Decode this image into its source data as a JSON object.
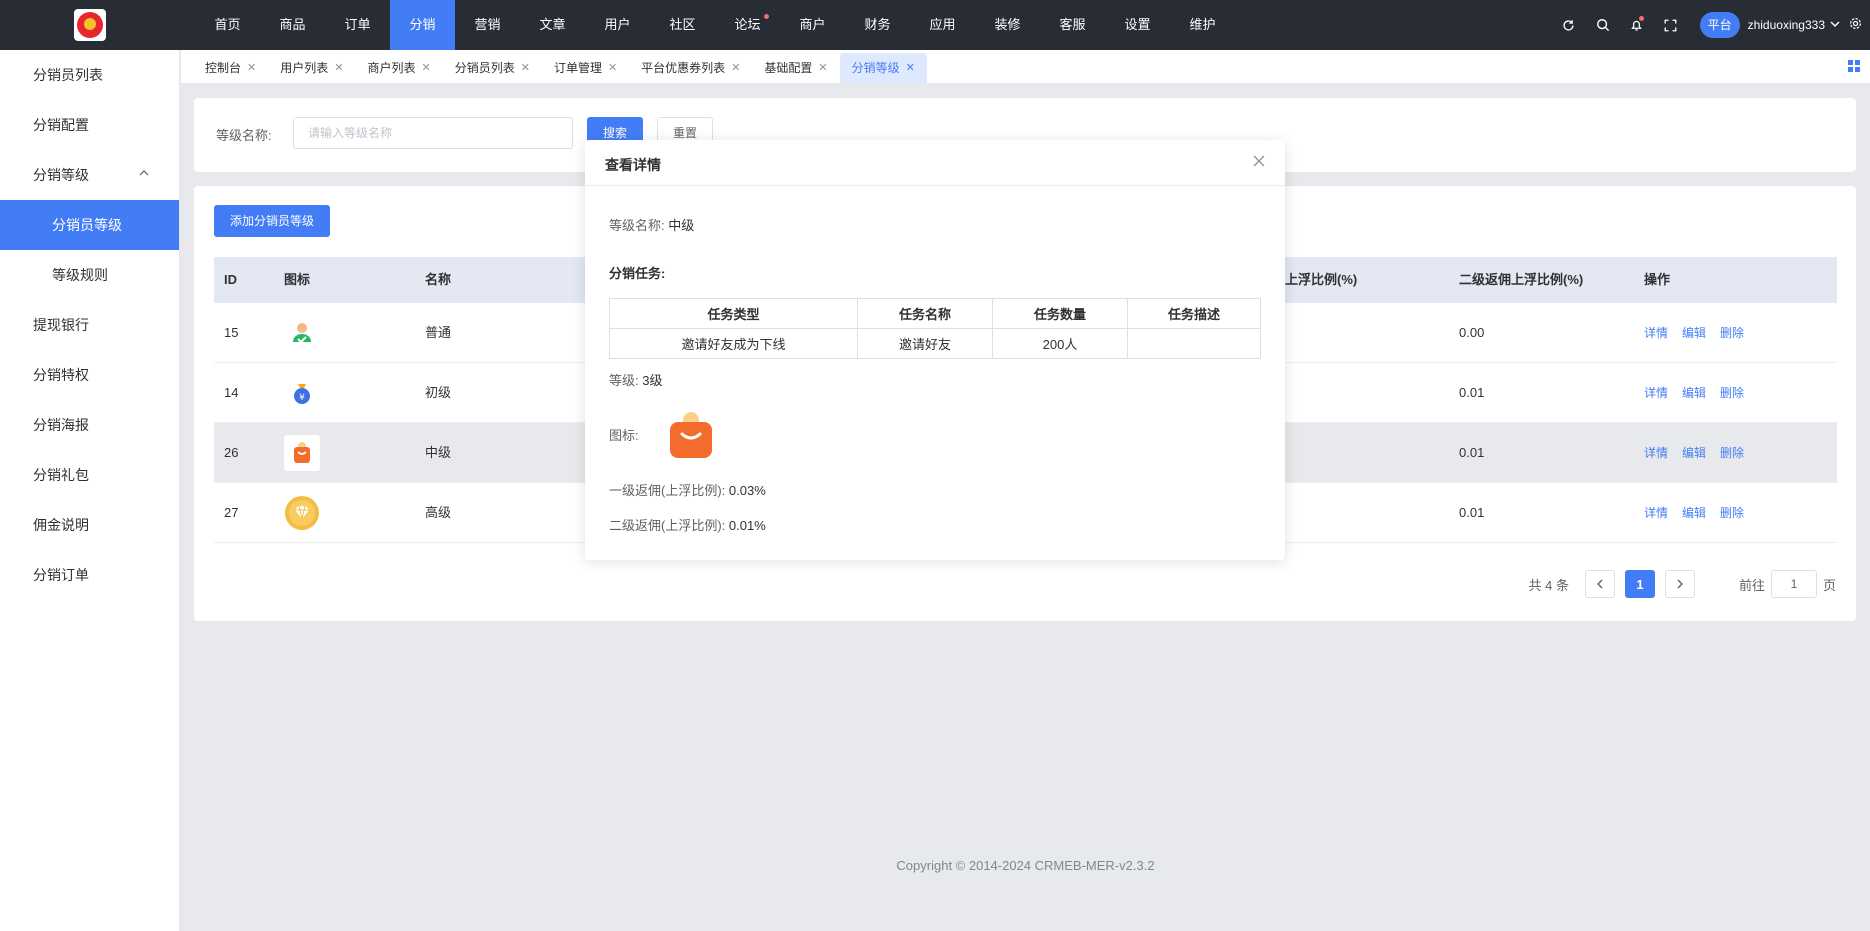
{
  "topnav": {
    "items": [
      "首页",
      "商品",
      "订单",
      "分销",
      "营销",
      "文章",
      "用户",
      "社区",
      "论坛",
      "商户",
      "财务",
      "应用",
      "装修",
      "客服",
      "设置",
      "维护"
    ],
    "active_index": 3,
    "badge_index": 8,
    "platform_label": "平台",
    "username": "zhiduoxing333"
  },
  "sidebar": {
    "items": [
      {
        "label": "分销员列表"
      },
      {
        "label": "分销配置"
      },
      {
        "label": "分销等级"
      },
      {
        "label": "分销员等级"
      },
      {
        "label": "等级规则"
      },
      {
        "label": "提现银行"
      },
      {
        "label": "分销特权"
      },
      {
        "label": "分销海报"
      },
      {
        "label": "分销礼包"
      },
      {
        "label": "佣金说明"
      },
      {
        "label": "分销订单"
      }
    ]
  },
  "tabs": [
    "控制台",
    "用户列表",
    "商户列表",
    "分销员列表",
    "订单管理",
    "平台优惠券列表",
    "基础配置",
    "分销等级"
  ],
  "search": {
    "label": "等级名称:",
    "placeholder": "请输入等级名称",
    "search_button": "搜索",
    "reset_button": "重置"
  },
  "table": {
    "add_button": "添加分销员等级",
    "columns": [
      "ID",
      "图标",
      "名称",
      "佣上浮比例(%)",
      "二级返佣上浮比例(%)",
      "操作"
    ],
    "rows": [
      {
        "id": "15",
        "name": "普通",
        "second_rate": "0.00",
        "icon": "green-badge-icon"
      },
      {
        "id": "14",
        "name": "初级",
        "second_rate": "0.01",
        "icon": "blue-coin-bag-icon"
      },
      {
        "id": "26",
        "name": "中级",
        "second_rate": "0.01",
        "icon": "orange-shopping-bag-icon"
      },
      {
        "id": "27",
        "name": "高级",
        "second_rate": "0.01",
        "icon": "gold-diamond-icon"
      }
    ],
    "ops": [
      "详情",
      "编辑",
      "删除"
    ]
  },
  "pagination": {
    "total_text": "共 4 条",
    "current_page": "1",
    "goto_prefix": "前往",
    "goto_value": "1",
    "goto_suffix": "页"
  },
  "footer": {
    "copyright": "Copyright © 2014-2024 CRMEB-MER-v2.3.2"
  },
  "modal": {
    "title": "查看详情",
    "level_name_label": "等级名称:",
    "level_name_value": "中级",
    "tasks_title": "分销任务:",
    "task_columns": [
      "任务类型",
      "任务名称",
      "任务数量",
      "任务描述"
    ],
    "task_rows": [
      {
        "type": "邀请好友成为下线",
        "name": "邀请好友",
        "count": "200人",
        "desc": ""
      }
    ],
    "grade_label": "等级:",
    "grade_value": "3级",
    "icon_label": "图标:",
    "first_rate_label": "一级返佣(上浮比例):",
    "first_rate_value": "0.03%",
    "second_rate_label": "二级返佣(上浮比例):",
    "second_rate_value": "0.01%"
  },
  "colors": {
    "accent": "#437df5",
    "topbar": "#282c34",
    "badge_red": "#f56c6c"
  }
}
